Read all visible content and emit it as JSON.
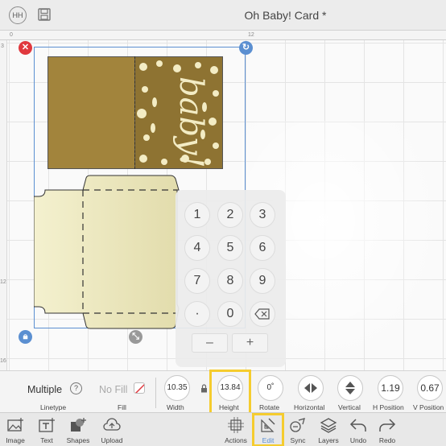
{
  "header": {
    "avatar_initials": "HH",
    "title": "Oh Baby! Card *"
  },
  "ruler": {
    "top_marks": [
      "0",
      "12"
    ],
    "left_marks": [
      "3",
      "12",
      "16"
    ]
  },
  "canvas": {
    "card_text": "baby!"
  },
  "keypad": {
    "keys": [
      "1",
      "2",
      "3",
      "4",
      "5",
      "6",
      "7",
      "8",
      "9",
      "·",
      "0"
    ],
    "minus": "–",
    "plus": "+"
  },
  "properties": {
    "linetype": {
      "value": "Multiple",
      "label": "Linetype",
      "help": "?"
    },
    "fill": {
      "value": "No Fill",
      "label": "Fill"
    },
    "width": {
      "value": "10.35",
      "label": "Width"
    },
    "height": {
      "value": "13.84",
      "label": "Height"
    },
    "rotate": {
      "value": "0˚",
      "label": "Rotate"
    },
    "horizontal": {
      "label": "Horizontal"
    },
    "vertical": {
      "label": "Vertical"
    },
    "h_position": {
      "value": "1.19",
      "label": "H Position"
    },
    "v_position": {
      "value": "0.67",
      "label": "V Position"
    }
  },
  "toolbar": {
    "items": [
      {
        "label": "Image",
        "icon": "image-icon"
      },
      {
        "label": "Text",
        "icon": "text-icon"
      },
      {
        "label": "Shapes",
        "icon": "shapes-icon"
      },
      {
        "label": "Upload",
        "icon": "upload-icon"
      },
      {
        "label": "Actions",
        "icon": "actions-icon"
      },
      {
        "label": "Edit",
        "icon": "edit-icon"
      },
      {
        "label": "Sync",
        "icon": "sync-icon"
      },
      {
        "label": "Layers",
        "icon": "layers-icon"
      },
      {
        "label": "Undo",
        "icon": "undo-icon"
      },
      {
        "label": "Redo",
        "icon": "redo-icon"
      }
    ]
  },
  "colors": {
    "card_gold": "#a2843c",
    "envelope": "#eeeac3",
    "highlight": "#f5cc2e",
    "selection": "#5b8fd1",
    "close_red": "#e0383e"
  }
}
